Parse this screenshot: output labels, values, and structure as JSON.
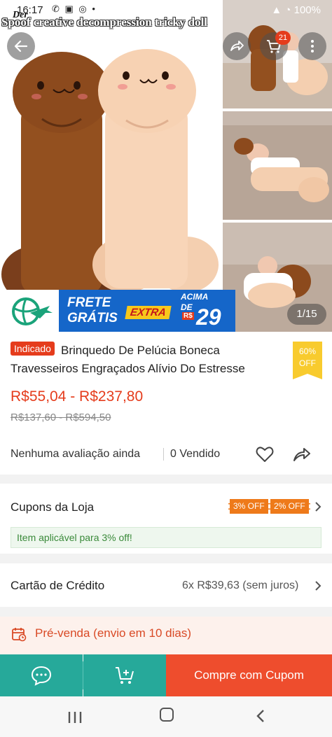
{
  "status_bar": {
    "time": "16:17",
    "icons_left": "✆ ▣ ◎ •",
    "battery": "100%"
  },
  "hero": {
    "brand_small": "Der",
    "overlay_title": "Spoof creative decompression tricky doll",
    "cart_count": "21",
    "image_counter": "1/15"
  },
  "shipping_banner": {
    "line1": "FRETE",
    "line2": "GRÁTIS",
    "extra": "EXTRA",
    "acima": "ACIMA",
    "de": "DE",
    "currency": "R$",
    "value": "29"
  },
  "product": {
    "badge": "Indicado",
    "title": "Brinquedo De Pelúcia Boneca Travesseiros Engraçados Alívio Do Estresse",
    "discount_percent": "60%",
    "discount_label": "OFF",
    "price": "R$55,04 - R$237,80",
    "old_price": "R$137,60 - R$594,50",
    "rating": "Nenhuma avaliação ainda",
    "sold": "0 Vendido"
  },
  "coupons": {
    "label": "Cupons da Loja",
    "tags": [
      "3% OFF",
      "2% OFF"
    ],
    "note": "Item aplicável para 3% off!"
  },
  "credit": {
    "label": "Cartão de Crédito",
    "value": "6x R$39,63 (sem juros)"
  },
  "presale": {
    "text": "Pré-venda (envio em 10 dias)"
  },
  "actions": {
    "buy_label": "Compre com Cupom"
  },
  "colors": {
    "accent": "#ee4d2d",
    "teal": "#26a99a",
    "banner_blue": "#1566c9"
  }
}
